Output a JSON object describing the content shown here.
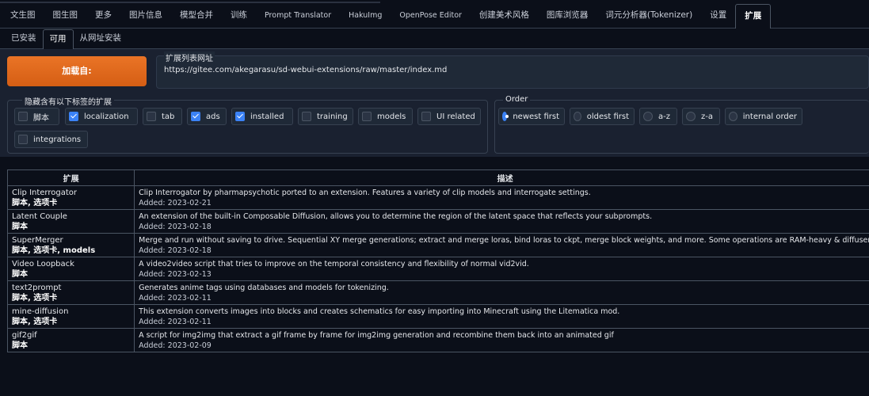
{
  "main_tabs": [
    {
      "label": "文生图"
    },
    {
      "label": "图生图"
    },
    {
      "label": "更多"
    },
    {
      "label": "图片信息"
    },
    {
      "label": "模型合并"
    },
    {
      "label": "训练"
    },
    {
      "label": "Prompt Translator"
    },
    {
      "label": "HakuImg"
    },
    {
      "label": "OpenPose Editor"
    },
    {
      "label": "创建美术风格"
    },
    {
      "label": "图库浏览器"
    },
    {
      "label": "词元分析器(Tokenizer)"
    },
    {
      "label": "设置"
    },
    {
      "label": "扩展"
    }
  ],
  "sub_tabs": [
    {
      "label": "已安装"
    },
    {
      "label": "可用"
    },
    {
      "label": "从网址安装"
    }
  ],
  "load_button": "加载自:",
  "url_field": {
    "label": "扩展列表网址",
    "value": "https://gitee.com/akegarasu/sd-webui-extensions/raw/master/index.md"
  },
  "hide_group": {
    "title": "隐藏含有以下标签的扩展",
    "options": [
      {
        "label": "脚本",
        "checked": false
      },
      {
        "label": "localization",
        "checked": true
      },
      {
        "label": "tab",
        "checked": false
      },
      {
        "label": "ads",
        "checked": true
      },
      {
        "label": "installed",
        "checked": true
      },
      {
        "label": "training",
        "checked": false
      },
      {
        "label": "models",
        "checked": false
      },
      {
        "label": "UI related",
        "checked": false
      },
      {
        "label": "integrations",
        "checked": false
      }
    ]
  },
  "order_group": {
    "title": "Order",
    "options": [
      {
        "label": "newest first",
        "selected": true
      },
      {
        "label": "oldest first",
        "selected": false
      },
      {
        "label": "a-z",
        "selected": false
      },
      {
        "label": "z-a",
        "selected": false
      },
      {
        "label": "internal order",
        "selected": false
      }
    ]
  },
  "table": {
    "headers": [
      "扩展",
      "描述"
    ],
    "rows": [
      {
        "name": "Clip Interrogator",
        "tags": "脚本, 选项卡",
        "description": "Clip Interrogator by pharmapsychotic ported to an extension. Features a variety of clip models and interrogate settings.",
        "added": "Added: 2023-02-21"
      },
      {
        "name": "Latent Couple",
        "tags": "脚本",
        "description": "An extension of the built-in Composable Diffusion, allows you to determine the region of the latent space that reflects your subprompts.",
        "added": "Added: 2023-02-18"
      },
      {
        "name": "SuperMerger",
        "tags": "脚本, 选项卡, models",
        "description": "Merge and run without saving to drive. Sequential XY merge generations; extract and merge loras, bind loras to ckpt, merge block weights, and more. Some operations are RAM-heavy & diffusers is requir",
        "added": "Added: 2023-02-18"
      },
      {
        "name": "Video Loopback",
        "tags": "脚本",
        "description": "A video2video script that tries to improve on the temporal consistency and flexibility of normal vid2vid.",
        "added": "Added: 2023-02-13"
      },
      {
        "name": "text2prompt",
        "tags": "脚本, 选项卡",
        "description": "Generates anime tags using databases and models for tokenizing.",
        "added": "Added: 2023-02-11"
      },
      {
        "name": "mine-diffusion",
        "tags": "脚本, 选项卡",
        "description": "This extension converts images into blocks and creates schematics for easy importing into Minecraft using the Litematica mod.",
        "added": "Added: 2023-02-11"
      },
      {
        "name": "gif2gif",
        "tags": "脚本",
        "description": "A script for img2img that extract a gif frame by frame for img2img generation and recombine them back into an animated gif",
        "added": "Added: 2023-02-09"
      }
    ]
  },
  "colors": {
    "accent": "#e3681c",
    "checkbox": "#3b82f6",
    "background": "#0b0f19",
    "panel": "#1a2130"
  }
}
